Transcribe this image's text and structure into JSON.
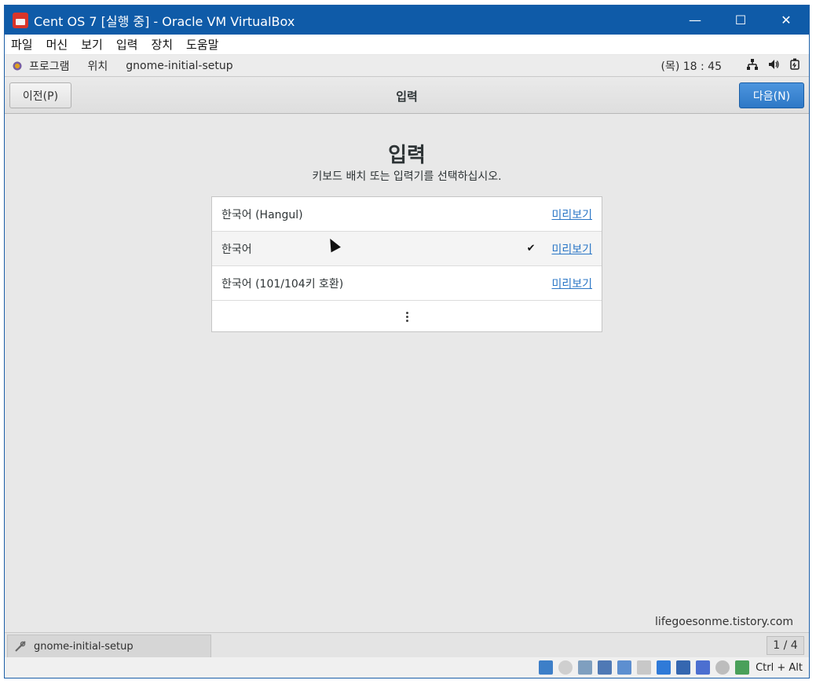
{
  "window": {
    "title": "Cent OS 7 [실행 중] - Oracle VM VirtualBox",
    "controls": {
      "minimize": "—",
      "maximize": "☐",
      "close": "✕"
    }
  },
  "menubar": {
    "items": [
      "파일",
      "머신",
      "보기",
      "입력",
      "장치",
      "도움말"
    ]
  },
  "gnome_top_bar": {
    "apps": "프로그램",
    "places": "위치",
    "active_app": "gnome-initial-setup",
    "clock": "(목) 18 : 45",
    "tray_icons": [
      "network-icon",
      "volume-icon",
      "power-icon"
    ]
  },
  "header_bar": {
    "prev_label": "이전(P)",
    "title": "입력",
    "next_label": "다음(N)"
  },
  "main": {
    "title": "입력",
    "subtitle": "키보드 배치 또는 입력기를 선택하십시오.",
    "input_sources": [
      {
        "name": "한국어 (Hangul)",
        "preview": "미리보기",
        "selected": false
      },
      {
        "name": "한국어",
        "preview": "미리보기",
        "selected": true,
        "check": "✔"
      },
      {
        "name": "한국어 (101/104키 호환)",
        "preview": "미리보기",
        "selected": false
      }
    ]
  },
  "watermark": "lifegoesonme.tistory.com",
  "taskbar": {
    "task_label": "gnome-initial-setup",
    "workspace": "1 / 4"
  },
  "statusbar": {
    "host_key": "Ctrl + Alt"
  },
  "colors": {
    "titlebar": "#0f5ba8",
    "next_button": "#3a83cf",
    "link": "#2a76c6",
    "content_bg": "#e8e8e8"
  }
}
